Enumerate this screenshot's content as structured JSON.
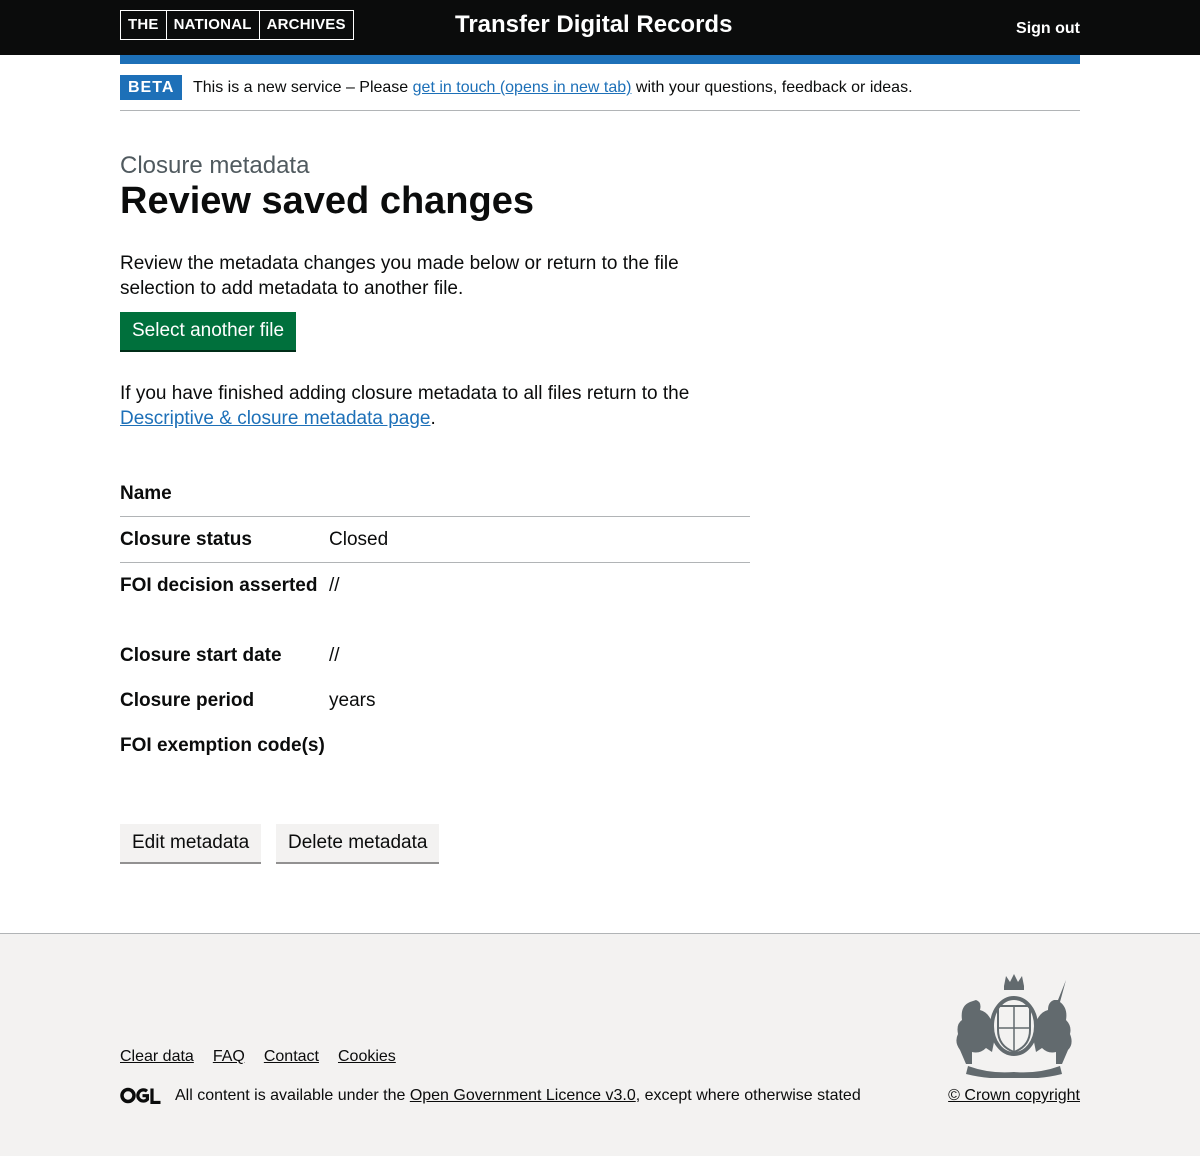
{
  "header": {
    "logo_parts": [
      "THE",
      "NATIONAL",
      "ARCHIVES"
    ],
    "service_name": "Transfer Digital Records",
    "sign_out": "Sign out"
  },
  "phase_banner": {
    "tag": "BETA",
    "text_before": "This is a new service – Please ",
    "link_text": "get in touch (opens in new tab)",
    "text_after": " with your questions, feedback or ideas."
  },
  "main": {
    "caption": "Closure metadata",
    "title": "Review saved changes",
    "intro": "Review the metadata changes you made below or return to the file selection to add metadata to another file.",
    "select_button": "Select another file",
    "finish_text": "If you have finished adding closure metadata to all files return to the ",
    "finish_link": "Descriptive & closure metadata page",
    "finish_end": "."
  },
  "summary": {
    "rows": [
      {
        "key": "Name",
        "value": ""
      },
      {
        "key": "Closure status",
        "value": "Closed"
      },
      {
        "key": "FOI decision asserted",
        "value": "//"
      },
      {
        "key": "Closure start date",
        "value": "//"
      },
      {
        "key": "Closure period",
        "value": "years"
      },
      {
        "key": "FOI exemption code(s)",
        "value": ""
      }
    ]
  },
  "actions": {
    "edit": "Edit metadata",
    "delete": "Delete metadata"
  },
  "footer": {
    "links": [
      "Clear data",
      "FAQ",
      "Contact",
      "Cookies"
    ],
    "licence_before": "All content is available under the ",
    "licence_link": "Open Government Licence v3.0",
    "licence_after": ", except where otherwise stated",
    "copyright": "© Crown copyright"
  },
  "colors": {
    "header_bg": "#0b0c0c",
    "brand_blue": "#1d70b8",
    "start_green": "#00703c",
    "footer_bg": "#f3f2f1"
  },
  "icons": {
    "ogl": "ogl-logo-icon",
    "crest": "royal-coat-of-arms-icon"
  }
}
